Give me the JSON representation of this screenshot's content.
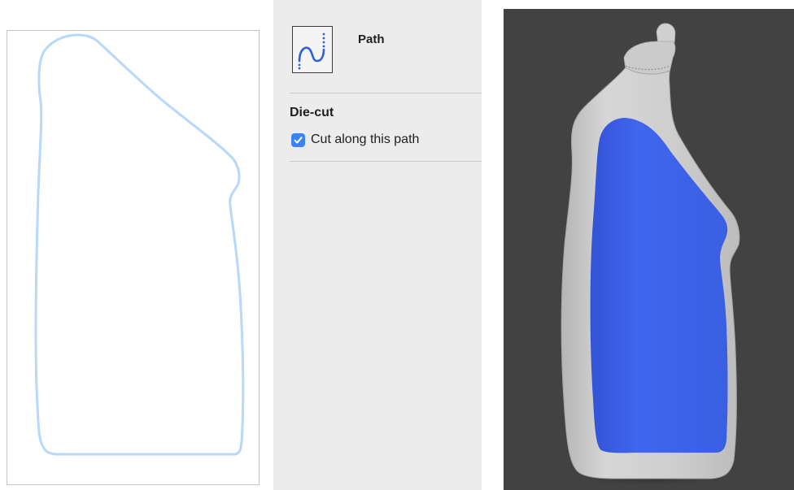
{
  "colors": {
    "path_stroke": "#b7d7fb",
    "preview_bg": "#424242",
    "bottle_body": "#c9c9c9",
    "label_blue": "#3e63e8",
    "checkbox_accent": "#3a83f7"
  },
  "inspector": {
    "icon": "path-icon",
    "title": "Path",
    "die_cut": {
      "section_title": "Die-cut",
      "checkbox_label": "Cut along this path",
      "checked": true
    }
  },
  "preview": {
    "object": "bottle-3d-model"
  }
}
